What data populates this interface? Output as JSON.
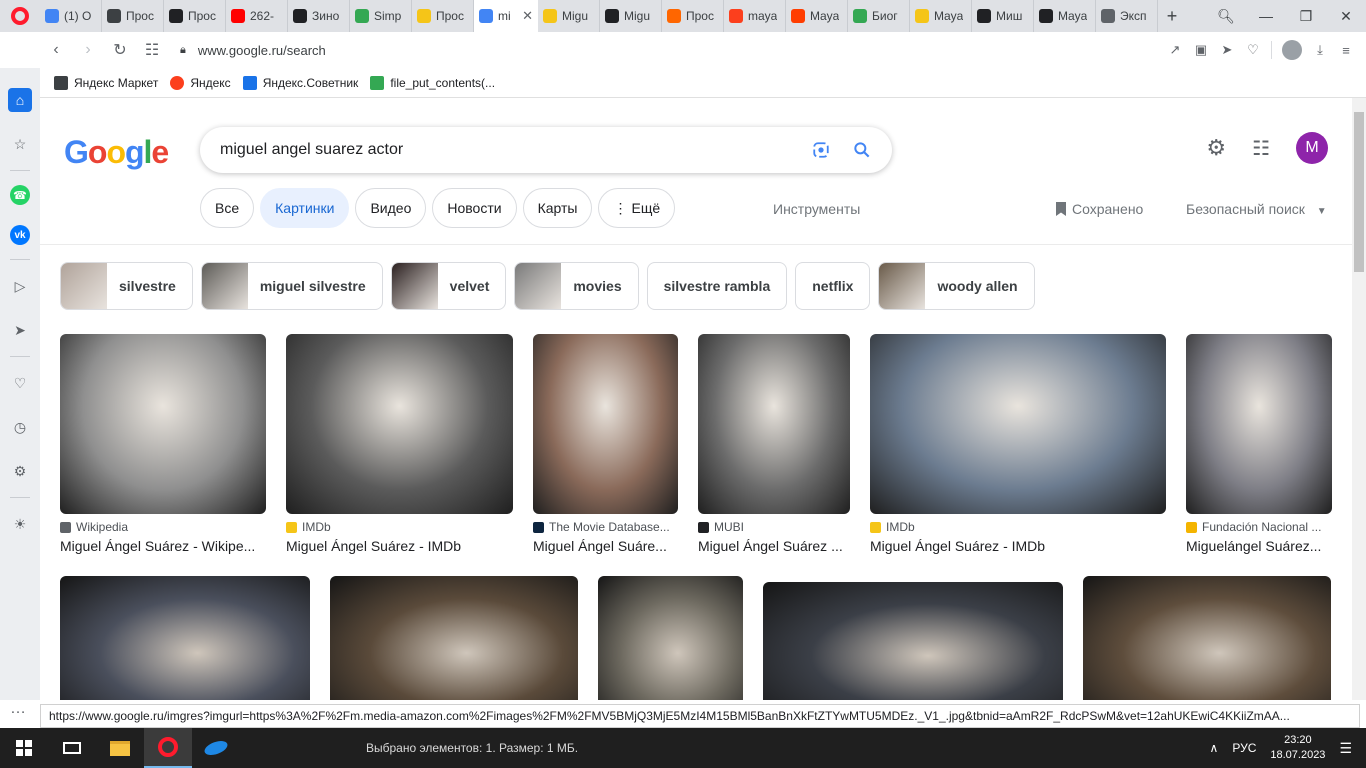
{
  "tabs": [
    {
      "icon": "pinwheel-icon",
      "color": "#4285f4",
      "title": "(1) O"
    },
    {
      "icon": "proton-icon",
      "color": "#3c4043",
      "title": "Прос"
    },
    {
      "icon": "wikipedia-icon",
      "color": "#202124",
      "title": "Прос"
    },
    {
      "icon": "youtube-icon",
      "color": "#ff0000",
      "title": "262-"
    },
    {
      "icon": "wikipedia-icon",
      "color": "#202124",
      "title": "Зино"
    },
    {
      "icon": "simple-icon",
      "color": "#34a853",
      "title": "Simp"
    },
    {
      "icon": "imdb-icon",
      "color": "#f5c518",
      "title": "Прос"
    },
    {
      "icon": "google-icon",
      "color": "#4285f4",
      "title": "mi",
      "active": true
    },
    {
      "icon": "imdb-icon",
      "color": "#f5c518",
      "title": "Migu"
    },
    {
      "icon": "wikipedia-icon",
      "color": "#202124",
      "title": "Migu"
    },
    {
      "icon": "kinopoisk-icon",
      "color": "#ff6600",
      "title": "Прос"
    },
    {
      "icon": "yandex-icon",
      "color": "#fc3f1d",
      "title": "maya"
    },
    {
      "icon": "flame-icon",
      "color": "#ff3d00",
      "title": "Maya"
    },
    {
      "icon": "simple-icon",
      "color": "#34a853",
      "title": "Биог"
    },
    {
      "icon": "imdb-icon",
      "color": "#f5c518",
      "title": "Maya"
    },
    {
      "icon": "wikipedia-icon",
      "color": "#202124",
      "title": "Миш"
    },
    {
      "icon": "wikipedia-icon",
      "color": "#202124",
      "title": "Maya"
    },
    {
      "icon": "grid-icon",
      "color": "#5f6368",
      "title": "Эксп"
    }
  ],
  "address": {
    "url": "www.google.ru/search"
  },
  "bookmarks": [
    {
      "icon": "file-icon",
      "label": "Яндекс Маркет"
    },
    {
      "icon": "yandex-icon",
      "label": "Яндекс"
    },
    {
      "icon": "cart-icon",
      "label": "Яндекс.Советник"
    },
    {
      "icon": "link-icon",
      "label": "file_put_contents(..."
    }
  ],
  "google": {
    "logo": "Google",
    "query": "miguel angel suarez actor",
    "avatar_letter": "M",
    "search_tabs": [
      {
        "label": "Все"
      },
      {
        "label": "Картинки",
        "active": true
      },
      {
        "label": "Видео"
      },
      {
        "label": "Новости"
      },
      {
        "label": "Карты"
      },
      {
        "label": "Ещё"
      }
    ],
    "tools": "Инструменты",
    "saved": "Сохранено",
    "safe_search": "Безопасный поиск",
    "related": [
      {
        "label": "silvestre",
        "thumb": "#b0a39a"
      },
      {
        "label": "miguel silvestre",
        "thumb": "#5d5b57"
      },
      {
        "label": "velvet",
        "thumb": "#2b2020"
      },
      {
        "label": "movies",
        "thumb": "#7a7a7a"
      },
      {
        "label": "silvestre rambla"
      },
      {
        "label": "netflix"
      },
      {
        "label": "woody allen",
        "thumb": "#6a5b4a"
      }
    ],
    "results_row1": [
      {
        "source": "Wikipedia",
        "fav": "#5f6368",
        "title": "Miguel Ángel Suárez - Wikipe...",
        "bg": "#8f8f8f"
      },
      {
        "source": "IMDb",
        "fav": "#f5c518",
        "title": "Miguel Ángel Suárez - IMDb",
        "bg": "#5b5b5b"
      },
      {
        "source": "The Movie Database...",
        "fav": "#0d253f",
        "title": "Miguel Ángel Suáre...",
        "bg": "#8a6a5a"
      },
      {
        "source": "MUBI",
        "fav": "#202124",
        "title": "Miguel Ángel Suárez ...",
        "bg": "#6c6c6c"
      },
      {
        "source": "IMDb",
        "fav": "#f5c518",
        "title": "Miguel Ángel Suárez - IMDb",
        "bg": "#6c7c90"
      },
      {
        "source": "Fundación Nacional ...",
        "fav": "#f4b400",
        "title": "Miguelángel Suárez...",
        "bg": "#7e7e86"
      }
    ],
    "results_row2": [
      {
        "bg": "#4a4f5c"
      },
      {
        "bg": "#5a4a3a"
      },
      {
        "bg": "#6e6a60"
      },
      {
        "bg": "#3b3f47"
      },
      {
        "bg": "#5e4d3c"
      }
    ]
  },
  "status_url": "https://www.google.ru/imgres?imgurl=https%3A%2F%2Fm.media-amazon.com%2Fimages%2FM%2FMV5BMjQ3MjE5MzI4M15BMl5BanBnXkFtZTYwMTU5MDEz._V1_.jpg&tbnid=aAmR2F_RdcPSwM&vet=12ahUKEwiC4KKiiZmAA...",
  "taskbar": {
    "explorer_status": "Выбрано элементов: 1. Размер: 1 МБ.",
    "lang": "РУС",
    "time": "23:20",
    "date": "18.07.2023"
  }
}
